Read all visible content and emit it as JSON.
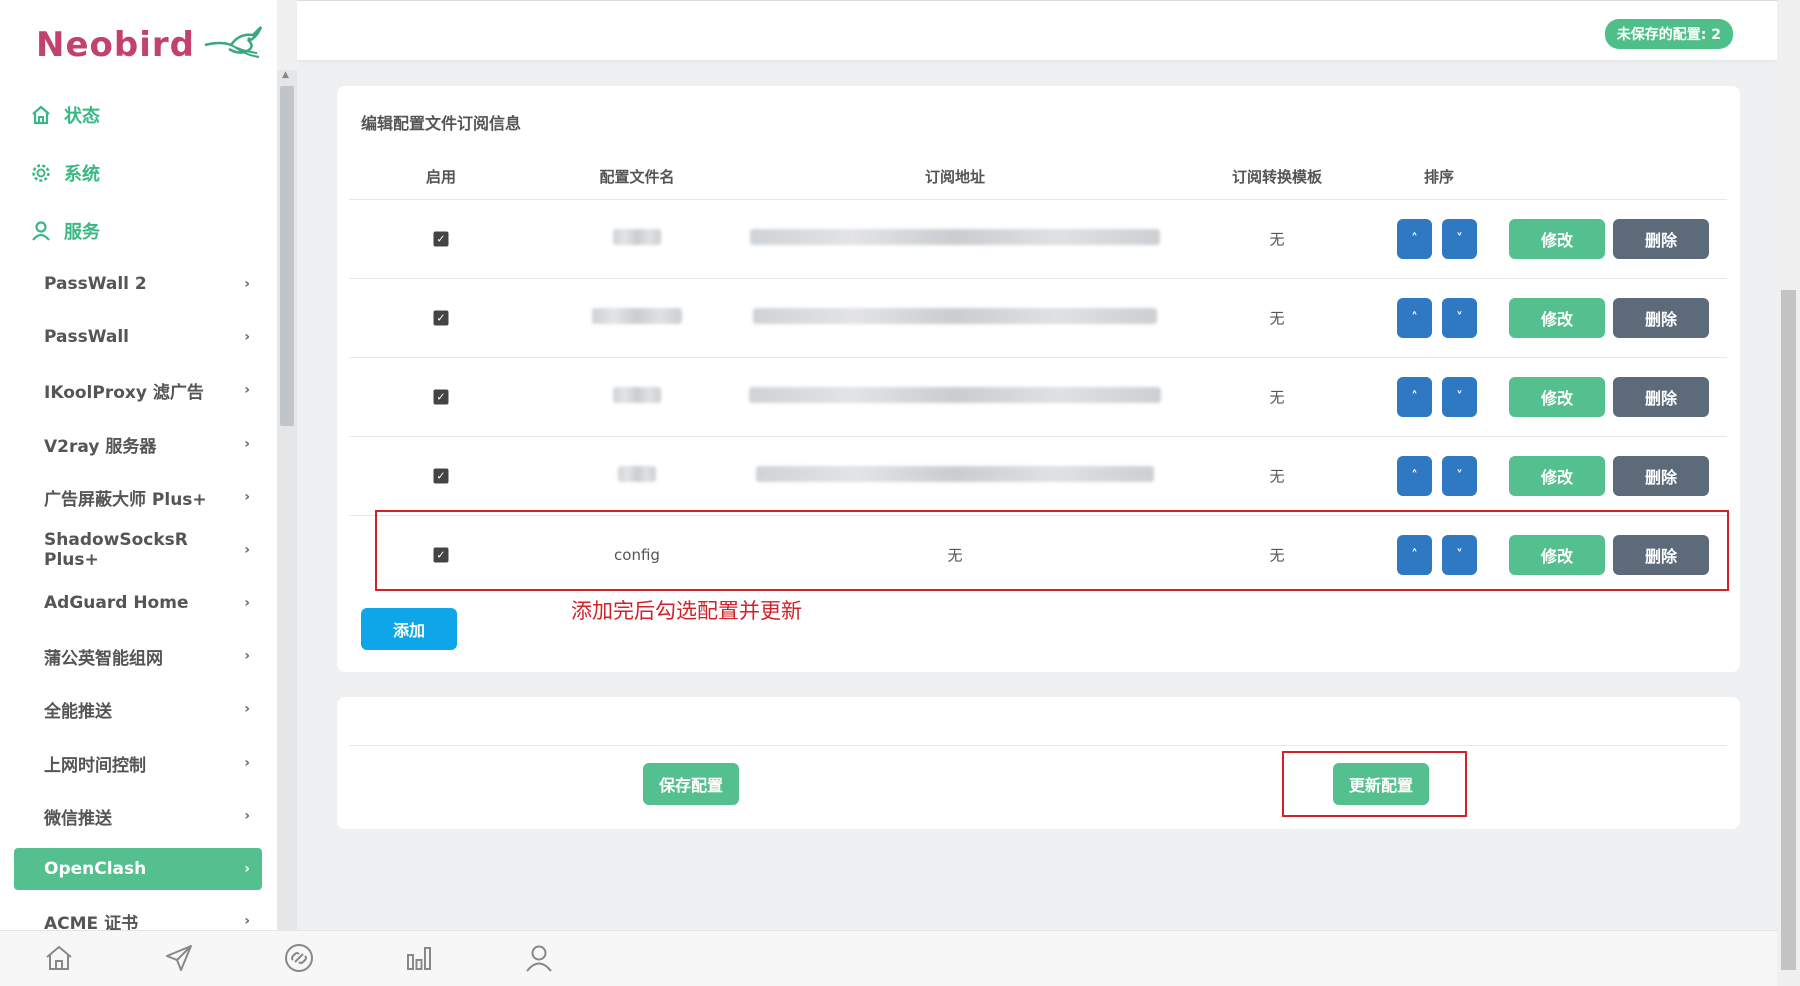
{
  "brand": {
    "name": "Neobird"
  },
  "header": {
    "unsaved_badge": "未保存的配置: 2"
  },
  "sidebar": {
    "top_items": [
      {
        "label": "状态",
        "icon": "home-icon"
      },
      {
        "label": "系统",
        "icon": "gear-icon"
      },
      {
        "label": "服务",
        "icon": "user-icon"
      }
    ],
    "items": [
      {
        "label": "PassWall 2"
      },
      {
        "label": "PassWall"
      },
      {
        "label": "IKoolProxy 滤广告"
      },
      {
        "label": "V2ray 服务器"
      },
      {
        "label": "广告屏蔽大师 Plus+"
      },
      {
        "label": "ShadowSocksR Plus+"
      },
      {
        "label": "AdGuard Home"
      },
      {
        "label": "蒲公英智能组网"
      },
      {
        "label": "全能推送"
      },
      {
        "label": "上网时间控制"
      },
      {
        "label": "微信推送"
      },
      {
        "label": "OpenClash",
        "active": true
      },
      {
        "label": "ACME 证书"
      }
    ]
  },
  "panel": {
    "title": "编辑配置文件订阅信息",
    "columns": [
      "启用",
      "配置文件名",
      "订阅地址",
      "订阅转换模板",
      "排序"
    ],
    "rows": [
      {
        "enabled": true,
        "name": "",
        "url": "",
        "template": "无",
        "redacted": true
      },
      {
        "enabled": true,
        "name": "",
        "url": "",
        "template": "无",
        "redacted": true
      },
      {
        "enabled": true,
        "name": "",
        "url": "",
        "template": "无",
        "redacted": true
      },
      {
        "enabled": true,
        "name": "",
        "url": "",
        "template": "无",
        "redacted": true
      },
      {
        "enabled": true,
        "name": "config",
        "url": "无",
        "template": "无",
        "redacted": false
      }
    ],
    "edit_label": "修改",
    "delete_label": "删除",
    "up_glyph": "˄",
    "down_glyph": "˅",
    "add_label": "添加",
    "annotation": "添加完后勾选配置并更新"
  },
  "actions": {
    "save_label": "保存配置",
    "update_label": "更新配置"
  },
  "bottom_bar": {
    "icons": [
      "home-icon",
      "send-icon",
      "link-icon",
      "stats-icon",
      "user-icon"
    ]
  },
  "colors": {
    "brand": "#c2416e",
    "accent_green": "#55c08f",
    "sort_blue": "#2f78c2",
    "delete_gray": "#5d6a7a",
    "add_blue": "#0ea6e9",
    "annotation_red": "#d3222a"
  }
}
